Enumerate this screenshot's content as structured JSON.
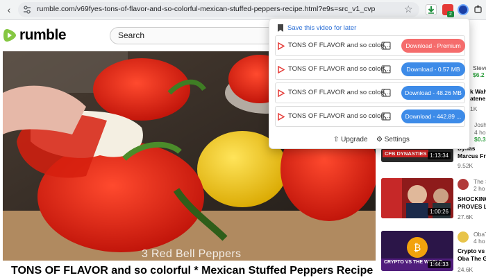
{
  "browser": {
    "url": "rumble.com/v69fyes-tons-of-flavor-and-so-colorful-mexican-stuffed-peppers-recipe.html?e9s=src_v1_cvp",
    "extension_badge": "2"
  },
  "site": {
    "logo": "rumble",
    "search_placeholder": "Search"
  },
  "video": {
    "caption": "3 Red Bell Peppers",
    "title": "TONS OF FLAVOR and so colorful * Mexican Stuffed Peppers Recipe"
  },
  "popup": {
    "save_label": "Save this video for later",
    "rows": [
      {
        "title": "TONS OF FLAVOR and so colorf...",
        "button": "Download - Premium"
      },
      {
        "title": "TONS OF FLAVOR and so colorf...",
        "button": "Download - 0.57 MB"
      },
      {
        "title": "TONS OF FLAVOR and so colorf...",
        "button": "Download - 48.26 MB"
      },
      {
        "title": "TONS OF FLAVOR and so colorf...",
        "button": "Download - 442.89 ..."
      }
    ],
    "upgrade_label": "Upgrade",
    "settings_label": "Settings"
  },
  "sidebar": {
    "partial_top": [
      {
        "line1": "Steve",
        "line2": "$6.2"
      },
      {
        "line1": "k Wahl",
        "line2": "atene"
      },
      {
        "line1": "1K",
        "line2": ""
      },
      {
        "line1": "Josh",
        "line2": "4 ho"
      },
      {
        "line1": "$0.3",
        "line2": ""
      }
    ],
    "videos": [
      {
        "thumb_text": "CFB DYNASTIES",
        "duration": "1:13:34",
        "title1": "Dynas",
        "title2": "Marcus Fr",
        "views": "9.52K"
      },
      {
        "thumb_text": "",
        "duration": "1:00:26",
        "channel": "The S",
        "age": "2 ho",
        "title1": "SHOCKING",
        "title2": "PROVES L",
        "views": "27.6K"
      },
      {
        "thumb_text": "CRYPTO VS THE WORLD",
        "duration": "1:44:33",
        "channel": "ObaT",
        "age": "4 ho",
        "title1": "Crypto vs",
        "title2": "Oba The G",
        "views": "24.6K"
      }
    ]
  }
}
